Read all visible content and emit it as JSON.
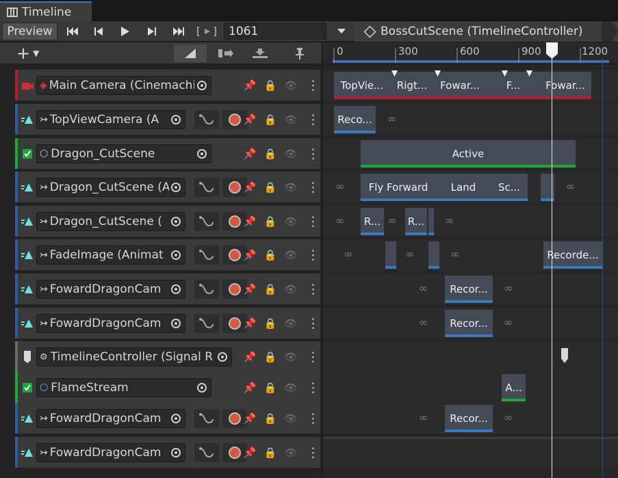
{
  "window": {
    "tab_title": "Timeline"
  },
  "toolbar": {
    "preview_label": "Preview",
    "frame_value": "1061",
    "breadcrumb": "BossCutScene (TimelineController)",
    "icons": [
      "first-frame-icon",
      "prev-frame-icon",
      "play-icon",
      "next-frame-icon",
      "last-frame-icon",
      "play-range-icon"
    ]
  },
  "subbar": {
    "add_label": "+"
  },
  "ruler": {
    "ticks": [
      "0",
      "300",
      "600",
      "900",
      "1200"
    ]
  },
  "tracks": [
    {
      "name": "Main Camera (Cinemachin",
      "type": "cinemachine",
      "stripe": "#b3202f"
    },
    {
      "name": "TopViewCamera (A",
      "type": "animation",
      "stripe": "#2d5c9c"
    },
    {
      "name": "Dragon_CutScene",
      "type": "activation",
      "stripe": "#1fa83a"
    },
    {
      "name": "Dragon_CutScene (Ani",
      "type": "animation",
      "stripe": "#2d5c9c"
    },
    {
      "name": "Dragon_CutScene (",
      "type": "animation",
      "stripe": "#2d5c9c"
    },
    {
      "name": "FadeImage (Animat",
      "type": "animation",
      "stripe": "#2d5c9c"
    },
    {
      "name": "FowardDragonCam",
      "type": "animation",
      "stripe": "#2d5c9c"
    },
    {
      "name": "FowardDragonCam",
      "type": "animation",
      "stripe": "#2d5c9c"
    },
    {
      "name": "TimelineController (Signal R",
      "type": "signal",
      "stripe": "#6a6a6a"
    },
    {
      "name": "FlameStream",
      "type": "activation",
      "stripe": "#1fa83a"
    },
    {
      "name": "FowardDragonCam",
      "type": "animation",
      "stripe": "#2d5c9c"
    },
    {
      "name": "FowardDragonCam",
      "type": "animation",
      "stripe": "#2d5c9c"
    }
  ],
  "clips": {
    "camera": [
      "TopVie...",
      "Rigt...",
      "Fowar...",
      "F...",
      "Fowar..."
    ],
    "topview": [
      "Reco..."
    ],
    "activation": [
      "Active"
    ],
    "dragon_anim": [
      "Fly Forward",
      "Land",
      "Sc..."
    ],
    "dragon_anim2": [
      "R...",
      "R..."
    ],
    "fade": [
      "Recorde..."
    ],
    "foward1": [
      "Recor..."
    ],
    "foward2": [
      "Recor..."
    ],
    "flame": [
      "A..."
    ],
    "foward3": [
      "Recor..."
    ]
  },
  "colors": {
    "camera": "#b3202f",
    "animation": "#3a79bb",
    "activation": "#1fa83a"
  }
}
